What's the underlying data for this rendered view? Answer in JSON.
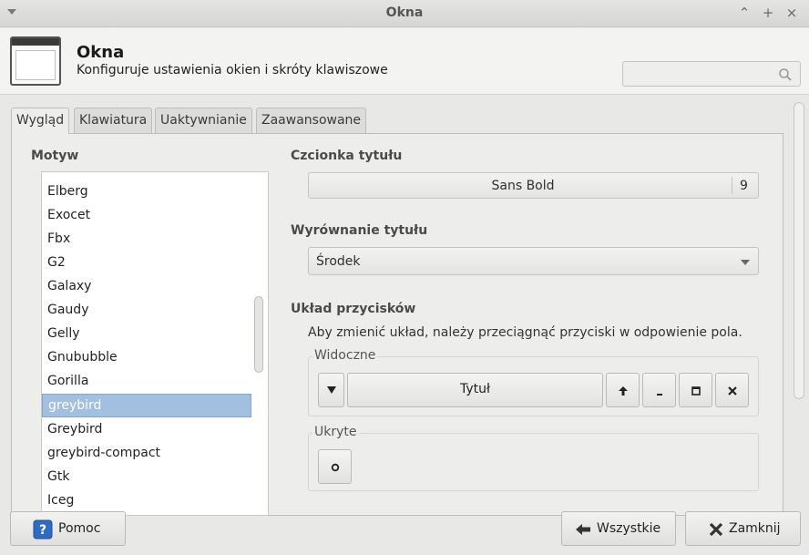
{
  "window": {
    "title": "Okna"
  },
  "header": {
    "title": "Okna",
    "subtitle": "Konfiguruje ustawienia okien i skróty klawiszowe",
    "search_placeholder": ""
  },
  "tabs": [
    {
      "label": "Wygląd",
      "active": true
    },
    {
      "label": "Klawiatura",
      "active": false
    },
    {
      "label": "Uaktywnianie",
      "active": false
    },
    {
      "label": "Zaawansowane",
      "active": false
    }
  ],
  "theme": {
    "label": "Motyw",
    "items": [
      "Elberg",
      "Exocet",
      "Fbx",
      "G2",
      "Galaxy",
      "Gaudy",
      "Gelly",
      "Gnububble",
      "Gorilla",
      "greybird",
      "Greybird",
      "greybird-compact",
      "Gtk",
      "Iceg"
    ],
    "selected": "greybird"
  },
  "title_font": {
    "label": "Czcionka tytułu",
    "name": "Sans Bold",
    "size": "9"
  },
  "title_alignment": {
    "label": "Wyrównanie tytułu",
    "value": "Środek"
  },
  "button_layout": {
    "label": "Układ przycisków",
    "description": "Aby zmienić układ, należy przeciągnąć przyciski w odpowienie pola.",
    "visible_label": "Widoczne",
    "title_button": "Tytuł",
    "hidden_label": "Ukryte"
  },
  "footer": {
    "help": "Pomoc",
    "all": "Wszystkie",
    "close": "Zamknij"
  }
}
